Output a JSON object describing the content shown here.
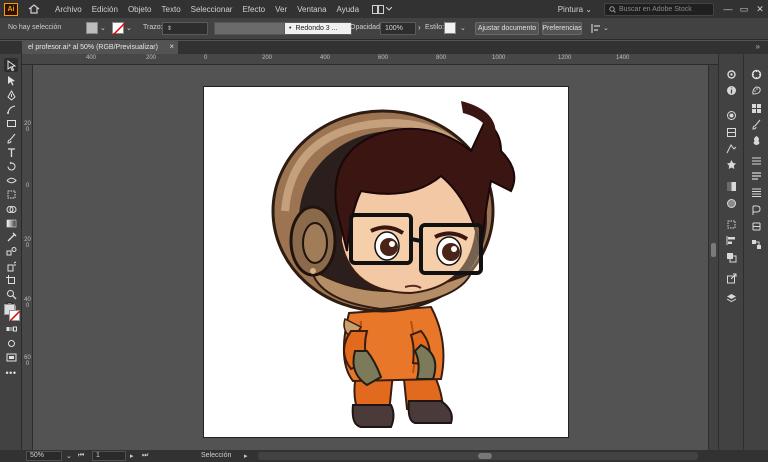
{
  "app": {
    "logo": "Ai"
  },
  "menu": [
    "Archivo",
    "Edición",
    "Objeto",
    "Texto",
    "Seleccionar",
    "Efecto",
    "Ver",
    "Ventana",
    "Ayuda"
  ],
  "workspace": "Pintura",
  "search": {
    "placeholder": "Buscar en Adobe Stock"
  },
  "control_bar": {
    "selection": "No hay selección",
    "stroke_label": "Trazo:",
    "brush": "Redondo 3 ...",
    "opacity_label": "Opacidad:",
    "opacity_value": "100%",
    "style_label": "Estilo:",
    "adjust_button": "Ajustar documento",
    "prefs_button": "Preferencias"
  },
  "document_tab": {
    "title": "el profesor.ai* al 50% (RGB/Previsualizar)",
    "close": "×"
  },
  "ruler": {
    "h_labels": [
      "400",
      "200",
      "0",
      "200",
      "400",
      "600",
      "800",
      "1000",
      "1200",
      "1400"
    ],
    "v_labels": [
      "200",
      "0",
      "200",
      "400",
      "600"
    ]
  },
  "status_bar": {
    "zoom": "50%",
    "artboard": "1",
    "tool": "Selección"
  },
  "colors": {
    "accent": "#ff9a00",
    "menubar": "#323232",
    "panel": "#424242",
    "canvas": "#535353",
    "artboard": "#ffffff"
  }
}
